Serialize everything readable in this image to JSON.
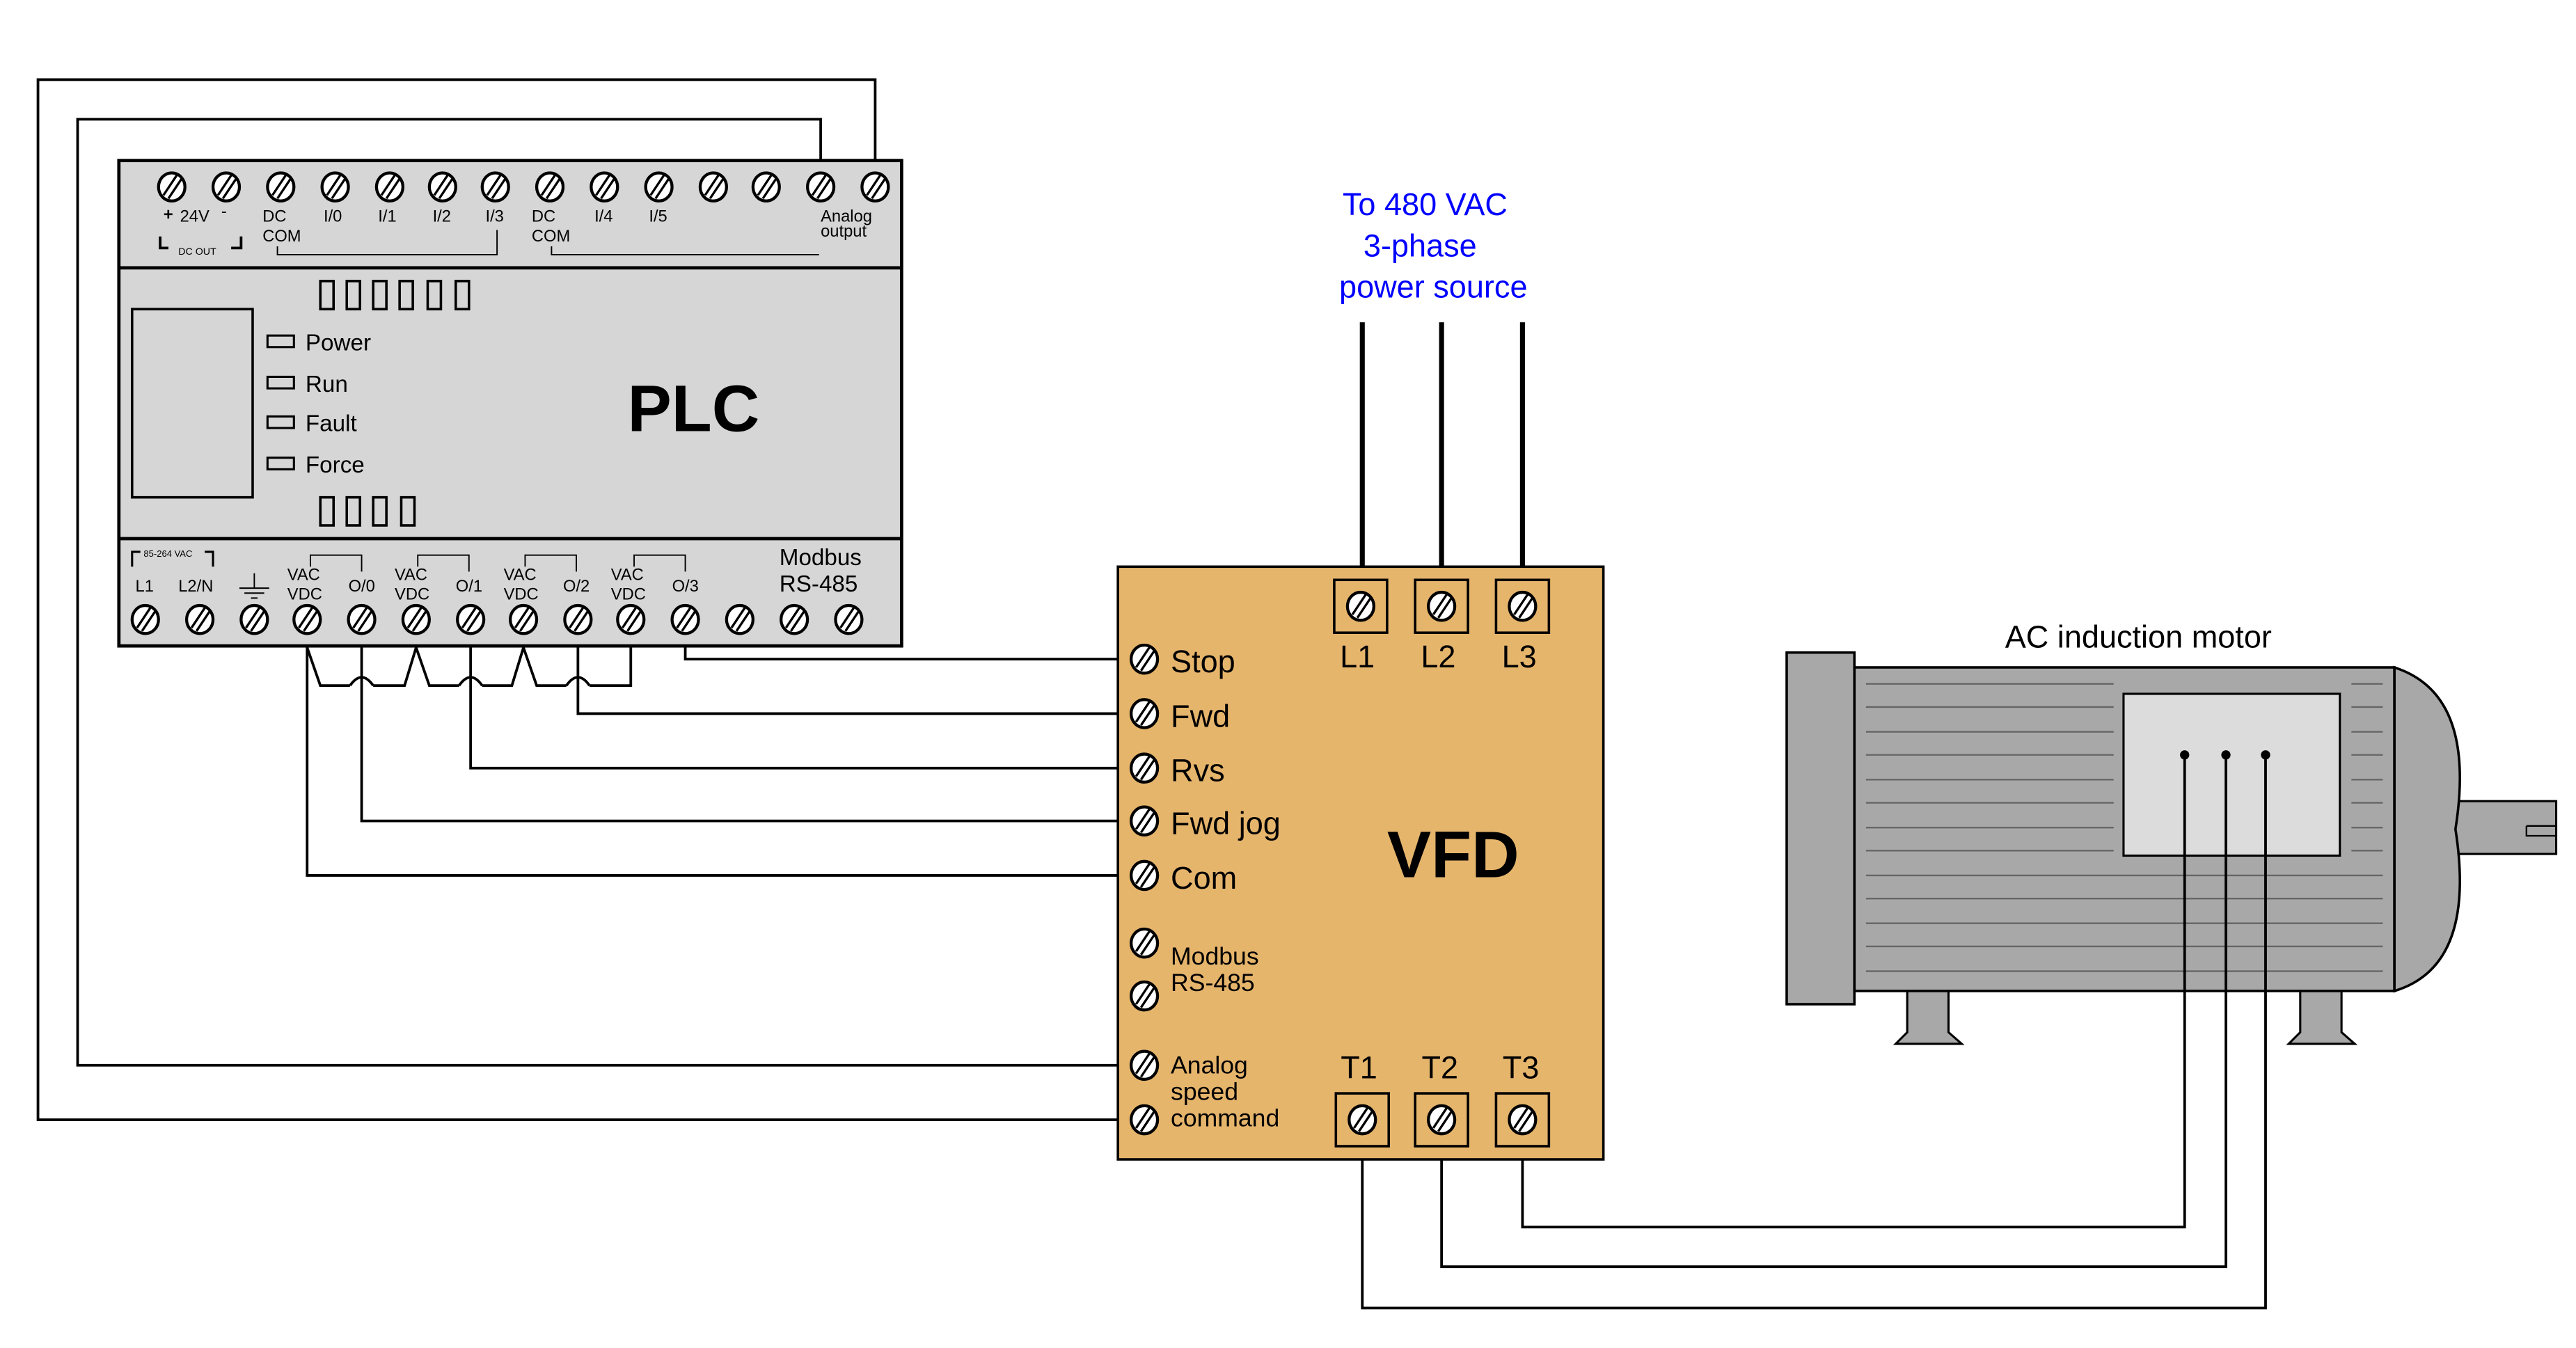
{
  "plc": {
    "title": "PLC",
    "top_labels": {
      "plus": "+",
      "v24": "24V",
      "minus": "-",
      "dcout": "DC OUT",
      "dc1": "DC",
      "com1": "COM",
      "i0": "I/0",
      "i1": "I/1",
      "i2": "I/2",
      "i3": "I/3",
      "dc2": "DC",
      "com2": "COM",
      "i4": "I/4",
      "i5": "I/5",
      "analog1": "Analog",
      "analog2": "output"
    },
    "indicators": [
      "Power",
      "Run",
      "Fault",
      "Force"
    ],
    "bottom_labels": {
      "vac_range": "85-264 VAC",
      "l1": "L1",
      "l2n": "L2/N",
      "vac": "VAC",
      "vdc": "VDC",
      "o0": "O/0",
      "o1": "O/1",
      "o2": "O/2",
      "o3": "O/3",
      "modbus": "Modbus",
      "rs485": "RS-485"
    }
  },
  "power_source": {
    "line1": "To 480 VAC",
    "line2": "3-phase",
    "line3": "power source"
  },
  "vfd": {
    "title": "VFD",
    "color": "#e6b56c",
    "inputs": [
      "L1",
      "L2",
      "L3"
    ],
    "outputs": [
      "T1",
      "T2",
      "T3"
    ],
    "terminals": [
      "Stop",
      "Fwd",
      "Rvs",
      "Fwd jog",
      "Com"
    ],
    "modbus1": "Modbus",
    "modbus2": "RS-485",
    "analog1": "Analog",
    "analog2": "speed",
    "analog3": "command"
  },
  "motor": {
    "label": "AC induction motor"
  },
  "colors": {
    "plc_body": "#d6d6d6",
    "label_blue": "#0000ff",
    "motor_gray": "#a8a8a8"
  }
}
